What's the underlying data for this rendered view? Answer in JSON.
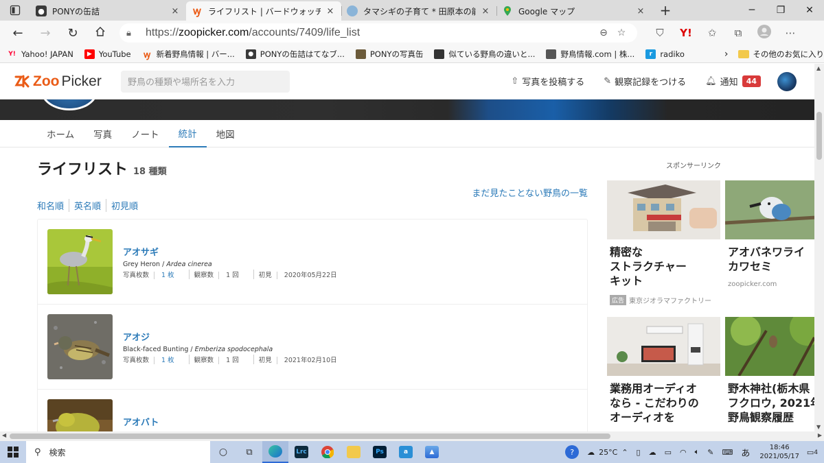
{
  "browser": {
    "tabs": [
      {
        "title": "PONYの缶詰",
        "close": "×",
        "active": false,
        "fav_color": "#3a3a3a"
      },
      {
        "title": "ライフリスト | バードウォッチングならZo",
        "close": "×",
        "active": true,
        "fav_color": "#ea5b16"
      },
      {
        "title": "タマシギの子育て * 田原本の能 *",
        "close": "×",
        "active": false,
        "fav_color": "#8ab4d8"
      },
      {
        "title": "Google マップ",
        "close": "×",
        "active": false,
        "fav_color": "#34a853"
      }
    ],
    "new_tab": "+",
    "window_controls": {
      "minimize": "─",
      "restore": "❐",
      "close": "✕"
    },
    "url_prefix": "https://",
    "url_host": "zoopicker.com",
    "url_path": "/accounts/7409/life_list",
    "bookmarks": [
      {
        "label": "Yahoo! JAPAN",
        "icon": "yahoo-icon",
        "color": "#ff0033",
        "glyph": "Y!"
      },
      {
        "label": "YouTube",
        "icon": "youtube-icon",
        "color": "#ff0000",
        "glyph": "▶"
      },
      {
        "label": "新着野鳥情報 | バー...",
        "icon": "zoopicker-icon",
        "color": "#ea5b16",
        "glyph": "Z"
      },
      {
        "label": "PONYの缶詰はてなブ...",
        "icon": "pony-icon",
        "color": "#3a3a3a",
        "glyph": "P"
      },
      {
        "label": "PONYの写真缶",
        "icon": "photo-icon",
        "color": "#6b5a3a",
        "glyph": "P"
      },
      {
        "label": "似ている野鳥の違いと...",
        "icon": "bird-icon",
        "color": "#333333",
        "glyph": "鳥"
      },
      {
        "label": "野鳥情報.com | 株...",
        "icon": "bird-info-icon",
        "color": "#555555",
        "glyph": "鳥"
      },
      {
        "label": "radiko",
        "icon": "radiko-icon",
        "color": "#1a9ae0",
        "glyph": "r"
      }
    ],
    "bookmarks_more": "›",
    "other_favorites": "その他のお気に入り"
  },
  "site": {
    "logo_zoo": "Zoo",
    "logo_picker": "Picker",
    "search_placeholder": "野鳥の種類や場所名を入力",
    "post_photo": "写真を投稿する",
    "add_record": "観察記録をつける",
    "notifications": "通知",
    "notification_count": "44",
    "subnav": [
      {
        "label": "ホーム",
        "active": false
      },
      {
        "label": "写真",
        "active": false
      },
      {
        "label": "ノート",
        "active": false
      },
      {
        "label": "統計",
        "active": true
      },
      {
        "label": "地図",
        "active": false
      }
    ],
    "page_title": "ライフリスト",
    "species_count": "18 種類",
    "unseen_link": "まだ見たことない野鳥の一覧",
    "sort_options": [
      "和名順",
      "英名順",
      "初見順"
    ],
    "birds": [
      {
        "name_jp": "アオサギ",
        "name_en": "Grey Heron",
        "name_sci": "Ardea cinerea",
        "photos_label": "写真枚数",
        "photos": "1 枚",
        "obs_label": "観察数",
        "obs": "1 回",
        "first_label": "初見",
        "first_seen": "2020年05月22日"
      },
      {
        "name_jp": "アオジ",
        "name_en": "Black-faced Bunting",
        "name_sci": "Emberiza spodocephala",
        "photos_label": "写真枚数",
        "photos": "1 枚",
        "obs_label": "観察数",
        "obs": "1 回",
        "first_label": "初見",
        "first_seen": "2021年02月10日"
      },
      {
        "name_jp": "アオバト",
        "name_en": "",
        "name_sci": "",
        "photos_label": "",
        "photos": "",
        "obs_label": "",
        "obs": "",
        "first_label": "",
        "first_seen": ""
      }
    ],
    "sponsor_label": "スポンサーリンク",
    "ads": [
      {
        "title": "精密な\nストラクチャー\nキット",
        "tag": "広告",
        "source": "東京ジオラマファクトリー"
      },
      {
        "title": "アオバネワライ\nカワセミ",
        "tag": "",
        "source": "zoopicker.com"
      },
      {
        "title": "業務用オーディオ\nなら - こだわりの\nオーディオを",
        "tag": "",
        "source": ""
      },
      {
        "title": "野木神社(栃木県\nフクロウ, 2021年\n野鳥観察履歴",
        "tag": "",
        "source": ""
      }
    ]
  },
  "taskbar": {
    "search_placeholder": "検索",
    "weather": "25°C",
    "ime": "あ",
    "time": "18:46",
    "date": "2021/05/17",
    "notification_count": "4"
  }
}
